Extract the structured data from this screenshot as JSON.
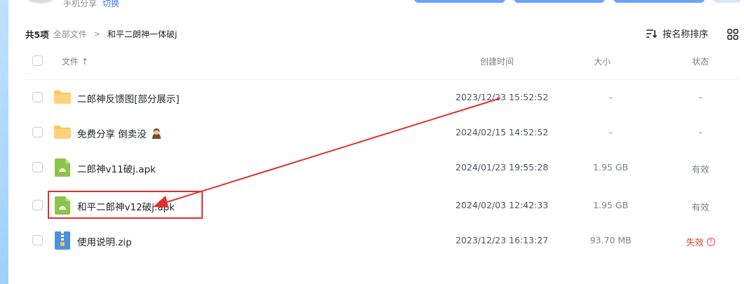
{
  "top": {
    "user_text": "手机分享",
    "switch_link": "切换"
  },
  "breadcrumb": {
    "count": "共5项",
    "root": "全部文件",
    "separator": ">",
    "current": "和平二朗神一体破j"
  },
  "toolbar": {
    "sort_label": "按名称排序",
    "sort_icon": "sort-icon",
    "view_icon": "grid-view-icon"
  },
  "columns": {
    "name": "文件 ↑",
    "time": "创建时间",
    "size": "大小",
    "status": "状态"
  },
  "files": [
    {
      "name": "二郎神反馈图[部分展示]",
      "time": "2023/12/23 15:52:52",
      "size": "-",
      "status": "-",
      "type": "folder"
    },
    {
      "name": "免费分享 倒卖没",
      "time": "2024/02/15 14:52:52",
      "size": "-",
      "status": "-",
      "type": "folder"
    },
    {
      "name": "二郎神v11破j.apk",
      "time": "2024/01/23 19:55:28",
      "size": "1.95 GB",
      "status": "有效",
      "type": "apk"
    },
    {
      "name": "和平二郎神v12破j.apk",
      "time": "2024/02/03 12:42:33",
      "size": "1.95 GB",
      "status": "有效",
      "type": "apk"
    },
    {
      "name": "使用说明.zip",
      "time": "2023/12/23 16:13:27",
      "size": "93.70 MB",
      "status": "失效",
      "type": "zip"
    }
  ],
  "colors": {
    "accent": "#3a7afe",
    "folder": "#ffc45c",
    "apk": "#8cc34a",
    "annotation": "#e0302c",
    "invalid": "#f04134"
  }
}
